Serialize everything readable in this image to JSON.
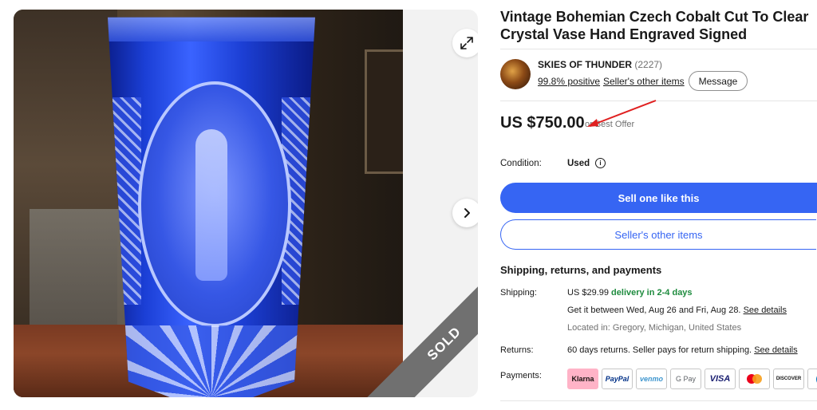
{
  "listing": {
    "title": "Vintage Bohemian Czech Cobalt Cut To Clear Crystal Vase Hand Engraved Signed",
    "sold_ribbon": "SOLD"
  },
  "seller": {
    "name": "SKIES OF THUNDER",
    "feedback_count": "(2227)",
    "positive": "99.8% positive",
    "other_items_link": "Seller's other items",
    "message_button": "Message"
  },
  "price": {
    "amount": "US $750.00",
    "note": "or Best Offer"
  },
  "condition": {
    "label": "Condition:",
    "value": "Used",
    "info_icon": "i"
  },
  "actions": {
    "primary": "Sell one like this",
    "secondary": "Seller's other items"
  },
  "shipping_section": {
    "heading": "Shipping, returns, and payments",
    "shipping_label": "Shipping:",
    "shipping_cost": "US $29.99",
    "shipping_speed": "delivery in 2-4 days",
    "delivery_window": "Get it between Wed, Aug 26 and Fri, Aug 28.",
    "see_details": "See details",
    "located_in": "Located in: Gregory, Michigan, United States",
    "returns_label": "Returns:",
    "returns_text": "60 days returns. Seller pays for return shipping.",
    "returns_details": "See details",
    "payments_label": "Payments:"
  },
  "payments": [
    "Klarna",
    "PayPal",
    "venmo",
    "G Pay",
    "VISA",
    "mastercard",
    "DISCOVER",
    "Diners Club"
  ],
  "colors": {
    "primary_blue": "#3665f3",
    "green": "#1e8b3e",
    "annotation_arrow": "#e02020"
  },
  "icons": {
    "expand": "expand-icon",
    "next": "chevron-right-icon",
    "info": "info-icon"
  }
}
